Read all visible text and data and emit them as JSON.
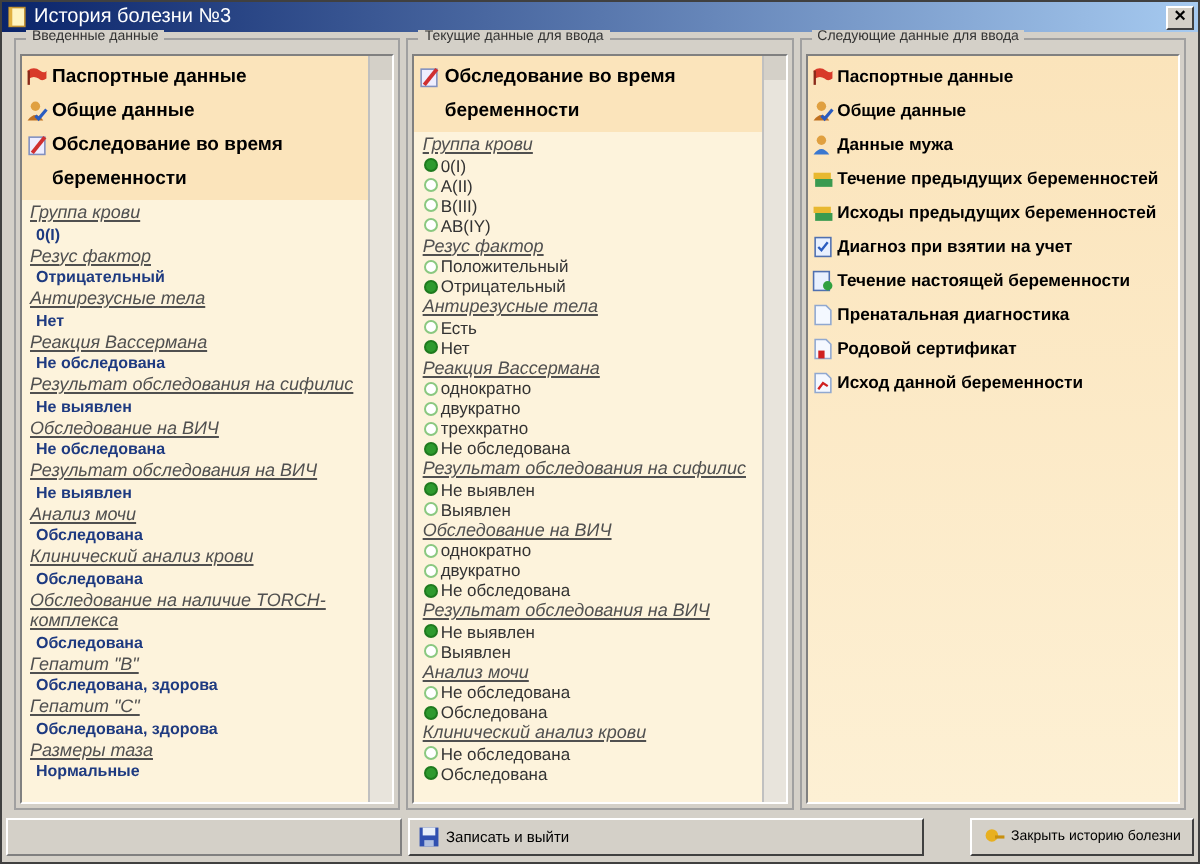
{
  "window": {
    "title": "История болезни №3",
    "close": "×"
  },
  "entered": {
    "legend": "Введенные данные",
    "sections": [
      {
        "label": "Паспортные данные"
      },
      {
        "label": "Общие данные"
      },
      {
        "label": "Обследование во время беременности"
      }
    ],
    "fields": [
      {
        "label": "Группа крови",
        "value": "0(I)"
      },
      {
        "label": "Резус фактор",
        "value": "Отрицательный"
      },
      {
        "label": "Антирезусные тела",
        "value": "Нет"
      },
      {
        "label": "Реакция Вассермана",
        "value": "Не обследована"
      },
      {
        "label": "Результат обследования на сифилис",
        "value": "Не выявлен"
      },
      {
        "label": "Обследование на ВИЧ",
        "value": "Не обследована"
      },
      {
        "label": "Результат обследования на ВИЧ",
        "value": "Не выявлен"
      },
      {
        "label": "Анализ мочи",
        "value": "Обследована"
      },
      {
        "label": "Клинический анализ крови",
        "value": "Обследована"
      },
      {
        "label": "Обследование на наличие TORCH-комплекса",
        "value": "Обследована"
      },
      {
        "label": "Гепатит \"B\"",
        "value": "Обследована, здорова"
      },
      {
        "label": "Гепатит \"C\"",
        "value": "Обследована, здорова"
      },
      {
        "label": "Размеры таза",
        "value": "Нормальные"
      }
    ]
  },
  "current": {
    "legend": "Текущие данные для ввода",
    "section": {
      "label": "Обследование во время беременности"
    },
    "groups": [
      {
        "label": "Группа крови",
        "options": [
          {
            "label": "0(I)",
            "selected": true
          },
          {
            "label": "A(II)",
            "selected": false
          },
          {
            "label": "B(III)",
            "selected": false
          },
          {
            "label": "AB(IY)",
            "selected": false
          }
        ]
      },
      {
        "label": "Резус фактор",
        "options": [
          {
            "label": "Положительный",
            "selected": false
          },
          {
            "label": "Отрицательный",
            "selected": true
          }
        ]
      },
      {
        "label": "Антирезусные тела",
        "options": [
          {
            "label": "Есть",
            "selected": false
          },
          {
            "label": "Нет",
            "selected": true
          }
        ]
      },
      {
        "label": "Реакция Вассермана",
        "options": [
          {
            "label": "однократно",
            "selected": false
          },
          {
            "label": "двукратно",
            "selected": false
          },
          {
            "label": "трехкратно",
            "selected": false
          },
          {
            "label": "Не обследована",
            "selected": true
          }
        ]
      },
      {
        "label": "Результат обследования на сифилис",
        "options": [
          {
            "label": "Не выявлен",
            "selected": true
          },
          {
            "label": "Выявлен",
            "selected": false
          }
        ]
      },
      {
        "label": "Обследование на ВИЧ",
        "options": [
          {
            "label": "однократно",
            "selected": false
          },
          {
            "label": "двукратно",
            "selected": false
          },
          {
            "label": "Не обследована",
            "selected": true
          }
        ]
      },
      {
        "label": "Результат обследования на ВИЧ",
        "options": [
          {
            "label": "Не выявлен",
            "selected": true
          },
          {
            "label": "Выявлен",
            "selected": false
          }
        ]
      },
      {
        "label": "Анализ мочи",
        "options": [
          {
            "label": "Не обследована",
            "selected": false
          },
          {
            "label": "Обследована",
            "selected": true
          }
        ]
      },
      {
        "label": "Клинический анализ крови",
        "options": [
          {
            "label": "Не обследована",
            "selected": false
          },
          {
            "label": "Обследована",
            "selected": true
          }
        ]
      }
    ]
  },
  "next": {
    "legend": "Следующие данные для ввода",
    "items": [
      {
        "label": "Паспортные данные"
      },
      {
        "label": "Общие данные"
      },
      {
        "label": "Данные мужа"
      },
      {
        "label": "Течение предыдущих беременностей"
      },
      {
        "label": "Исходы предыдущих беременностей"
      },
      {
        "label": "Диагноз при взятии на учет"
      },
      {
        "label": "Течение настоящей беременности"
      },
      {
        "label": "Пренатальная диагностика"
      },
      {
        "label": "Родовой сертификат"
      },
      {
        "label": "Исход данной беременности"
      }
    ]
  },
  "buttons": {
    "save": "Записать и выйти",
    "close": "Закрыть историю болезни"
  }
}
